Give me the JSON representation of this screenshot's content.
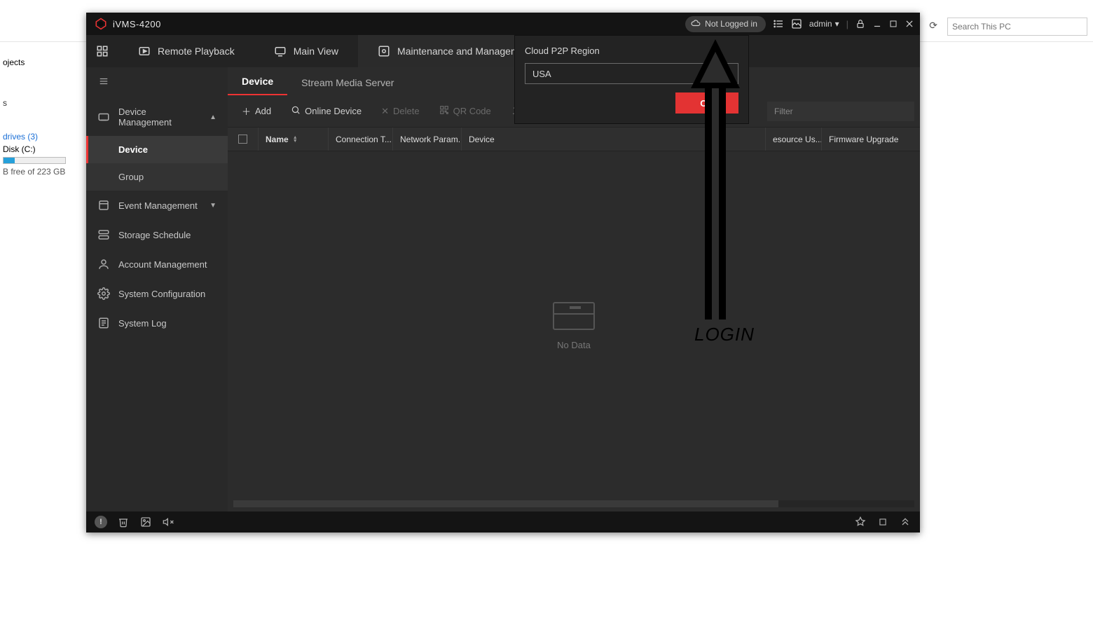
{
  "explorer": {
    "search_placeholder": "Search This PC",
    "objects": "ojects",
    "s_row": "s",
    "drives": "drives (3)",
    "disk": "Disk (C:)",
    "free": "B free of 223 GB"
  },
  "app": {
    "title": "iVMS-4200",
    "login_status": "Not Logged in",
    "user": "admin"
  },
  "top_tabs": {
    "remote": "Remote Playback",
    "main": "Main View",
    "maint": "Maintenance and Management"
  },
  "sidebar": {
    "device_mgmt": "Device Management",
    "device": "Device",
    "group": "Group",
    "event_mgmt": "Event Management",
    "storage": "Storage Schedule",
    "account": "Account Management",
    "sysconf": "System Configuration",
    "syslog": "System Log"
  },
  "subtabs": {
    "device": "Device",
    "stream": "Stream Media Server"
  },
  "toolbar": {
    "add": "Add",
    "online": "Online Device",
    "delete": "Delete",
    "qr": "QR Code",
    "filter_placeholder": "Filter"
  },
  "columns": {
    "name": "Name",
    "conn": "Connection T...",
    "netp": "Network Param...",
    "dev": "Device",
    "res": "esource Us...",
    "fw": "Firmware Upgrade"
  },
  "empty_text": "No Data",
  "popup": {
    "label": "Cloud P2P Region",
    "value": "USA",
    "ok": "OK"
  },
  "annotation": "LOGIN"
}
